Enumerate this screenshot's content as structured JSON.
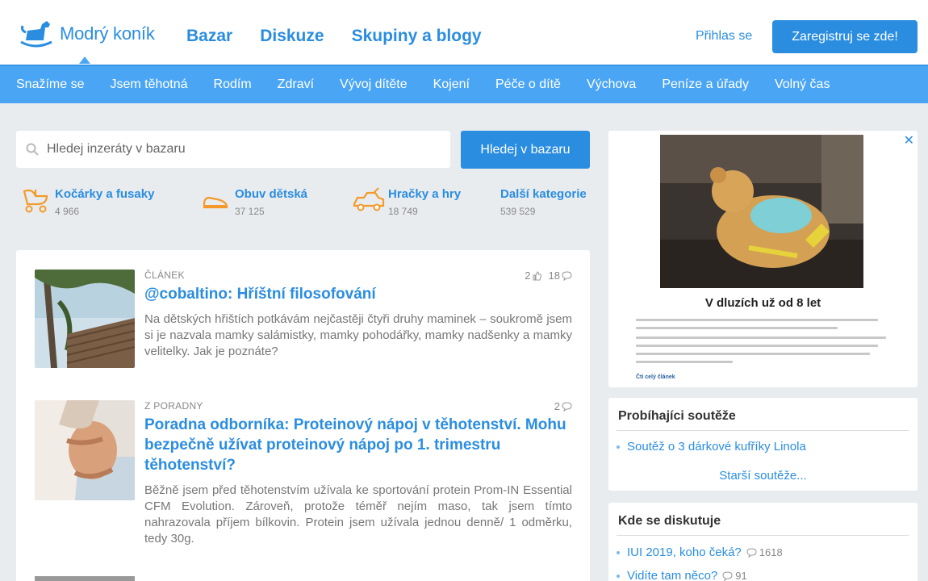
{
  "header": {
    "logo_text": "Modrý koník",
    "nav": [
      "Bazar",
      "Diskuze",
      "Skupiny a blogy"
    ],
    "login": "Přihlas se",
    "register": "Zaregistruj se zde!"
  },
  "categories_nav": [
    "Snažíme se",
    "Jsem těhotná",
    "Rodím",
    "Zdraví",
    "Vývoj dítěte",
    "Kojení",
    "Péče o dítě",
    "Výchova",
    "Peníze a úřady",
    "Volný čas"
  ],
  "bazar": {
    "search_placeholder": "Hledej inzeráty v bazaru",
    "search_button": "Hledej v bazaru",
    "categories": [
      {
        "name": "Kočárky a fusaky",
        "count": "4 966",
        "icon": "stroller-icon"
      },
      {
        "name": "Obuv dětská",
        "count": "37 125",
        "icon": "shoe-icon"
      },
      {
        "name": "Hračky a hry",
        "count": "18 749",
        "icon": "toy-car-icon"
      },
      {
        "name": "Další kategorie",
        "count": "539 529",
        "icon": ""
      }
    ]
  },
  "articles": [
    {
      "category": "Článek",
      "likes": "2",
      "comments": "18",
      "title": "@cobaltino: Hříštní filosofování",
      "excerpt": "Na dětských hřištích potkávám nejčastěji čtyři druhy maminek – soukromě jsem si je nazvala mamky salámistky, mamky pohodářky, mamky nadšenky a mamky velitelky. Jak je poznáte?"
    },
    {
      "category": "Z poradny",
      "comments": "2",
      "title": "Poradna odborníka: Proteinový nápoj v těhotenství. Mohu bezpečně užívat proteinový nápoj po 1. trimestru těhotenství?",
      "excerpt": "Běžně jsem před těhotenstvím užívala ke sportování protein Prom-IN Essential CFM Evolution. Zároveň, protože téměř nejím maso, tak jsem tímto nahrazovala příjem bílkovin. Protein jsem užívala jednou denně/ 1 odměrku, tedy 30g."
    }
  ],
  "ad": {
    "close": "✕",
    "title": "V dluzích už od 8 let",
    "link": "Čti celý článek"
  },
  "contests": {
    "title": "Probíhajíci soutěže",
    "items": [
      "Soutěž o 3 dárkové kufříky Linola"
    ],
    "older": "Starší soutěže..."
  },
  "discussions": {
    "title": "Kde se diskutuje",
    "items": [
      {
        "label": "IUI 2019, koho čeká?",
        "count": "1618"
      },
      {
        "label": "Vidíte tam něco?",
        "count": "91"
      }
    ]
  },
  "colors": {
    "accent": "#2a8de0",
    "catbar": "#4aa6f5",
    "orange": "#f39a2a"
  }
}
